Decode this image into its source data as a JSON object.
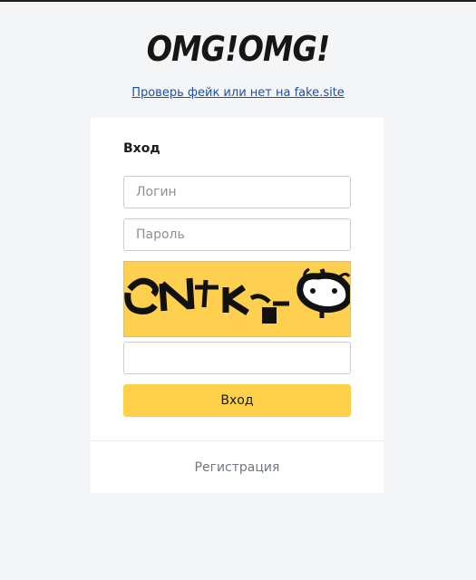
{
  "brand": {
    "logo_text": "OMG!OMG!"
  },
  "check_link": {
    "label": "Проверь фейк или нет на fake.site"
  },
  "login_form": {
    "title": "Вход",
    "login_placeholder": "Логин",
    "password_placeholder": "Пароль",
    "captcha_value": "",
    "submit_label": "Вход",
    "register_label": "Регистрация"
  },
  "colors": {
    "page_background": "#f4f5f7",
    "accent": "#ffd04a",
    "link": "#1e4fa7"
  }
}
